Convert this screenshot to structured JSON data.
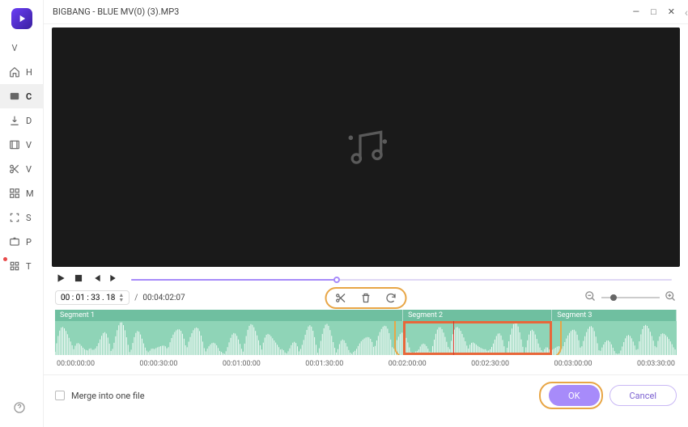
{
  "title": "BIGBANG - BLUE MV(0) (3).MP3",
  "sidebar": {
    "items": [
      {
        "label": "V",
        "icon": "logo"
      },
      {
        "label": "H",
        "icon": "home"
      },
      {
        "label": "C",
        "icon": "convert"
      },
      {
        "label": "D",
        "icon": "download"
      },
      {
        "label": "V",
        "icon": "film"
      },
      {
        "label": "V",
        "icon": "scissors"
      },
      {
        "label": "M",
        "icon": "grid"
      },
      {
        "label": "S",
        "icon": "focus"
      },
      {
        "label": "P",
        "icon": "tv"
      },
      {
        "label": "T",
        "icon": "apps"
      }
    ]
  },
  "window_controls": {
    "min": "—",
    "max": "□",
    "close": "✕"
  },
  "playback": {
    "current_time": "00 : 01 : 33 . 18",
    "total_time": "00:04:02:07",
    "progress_pct": 38
  },
  "segments": [
    {
      "label": "Segment 1",
      "width_pct": 56
    },
    {
      "label": "Segment 2",
      "width_pct": 24
    },
    {
      "label": "Segment 3",
      "width_pct": 20
    }
  ],
  "selection": {
    "left_pct": 56,
    "width_pct": 24
  },
  "playhead_pct": 64,
  "ruler_marks": [
    "00:00:00:00",
    "00:00:30:00",
    "00:01:00:00",
    "00:01:30:00",
    "00:02:00:00",
    "00:02:30:00",
    "00:03:00:00",
    "00:03:30:00"
  ],
  "footer": {
    "merge_label": "Merge into one file",
    "ok": "OK",
    "cancel": "Cancel"
  }
}
